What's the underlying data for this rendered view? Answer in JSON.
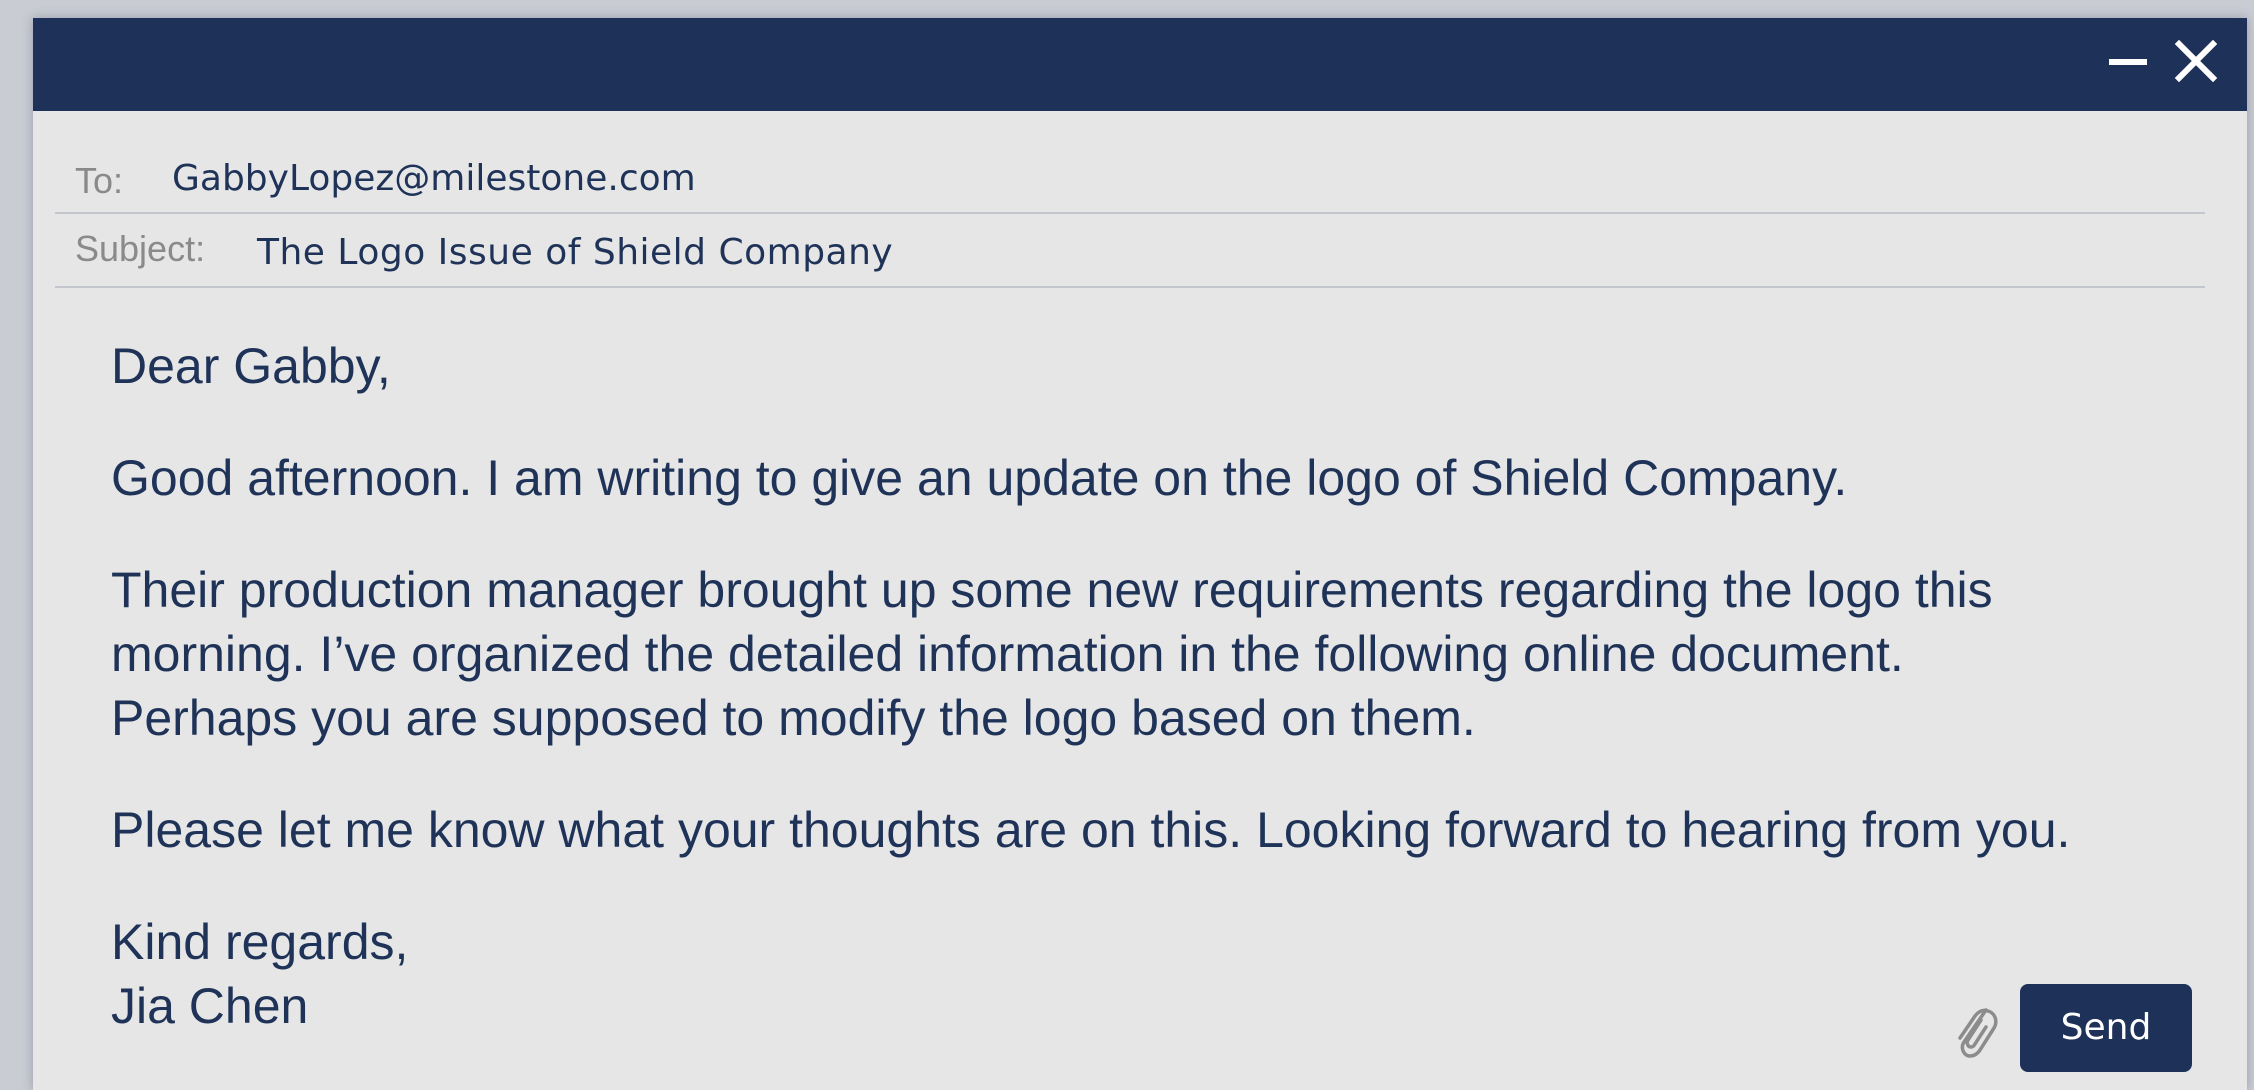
{
  "window": {
    "minimize_icon": "minimize-icon",
    "close_icon": "close-icon",
    "accent_color": "#1e3158"
  },
  "email": {
    "to_label": "To:",
    "to_value": "GabbyLopez@milestone.com",
    "subject_label": "Subject:",
    "subject_value": "The Logo Issue of Shield Company",
    "body": {
      "greeting": "Dear Gabby,",
      "paragraph1": "Good afternoon. I am writing to give an update on the logo of Shield Company.",
      "paragraph2": "Their production manager brought up some new requirements regarding the logo this\nmorning. I’ve organized the detailed information in the following online document.\nPerhaps you are supposed to modify the logo based on them.",
      "paragraph3": "Please let me know what your thoughts are on this. Looking forward to hearing from you.",
      "closing": "Kind regards,\nJia Chen"
    }
  },
  "actions": {
    "attach_icon": "paperclip-icon",
    "send_label": "Send"
  }
}
